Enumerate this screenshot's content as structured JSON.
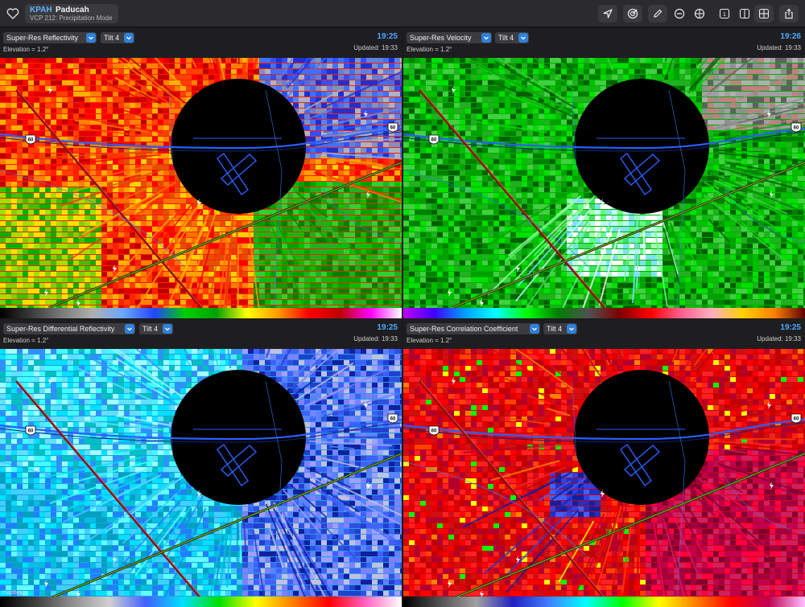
{
  "station": {
    "code": "KPAH",
    "name": "Paducah",
    "vcp": "VCP 212: Precipitation Mode"
  },
  "toolbar": {
    "icons": [
      "location-arrow-icon",
      "radar-sweep-icon",
      "pencil-icon",
      "minus-circle-icon",
      "crosshair-icon",
      "single-layout-icon",
      "dual-layout-icon",
      "quad-layout-icon",
      "share-icon"
    ],
    "single_layout_label": "1"
  },
  "panels": [
    {
      "product": "Super-Res Reflectivity",
      "tilt": "Tilt 4",
      "time": "19:25",
      "elevation": "Elevation = 1.2°",
      "updated": "Updated: 19:33",
      "palette": "reflectivity",
      "colorbar": [
        "#000000",
        "#3a3a3a",
        "#7a7a7a",
        "#b0b0b0",
        "#6aa6ff",
        "#2244ff",
        "#00d000",
        "#00a000",
        "#ffff00",
        "#ff9a00",
        "#ff0000",
        "#c00000",
        "#ff00ff",
        "#ffffff"
      ]
    },
    {
      "product": "Super-Res Velocity",
      "tilt": "Tilt 4",
      "time": "19:26",
      "elevation": "Elevation = 1.2°",
      "updated": "Updated: 19:33",
      "palette": "velocity",
      "colorbar": [
        "#c000ff",
        "#4000ff",
        "#00a0ff",
        "#00ffff",
        "#00ff00",
        "#008000",
        "#505050",
        "#800000",
        "#ff0000",
        "#ff6090",
        "#ffb0c0",
        "#ffd000",
        "#ff8000",
        "#600000"
      ]
    },
    {
      "product": "Super-Res Differential Reflectivity",
      "tilt": "Tilt 4",
      "time": "19:25",
      "elevation": "Elevation = 1.2°",
      "updated": "Updated: 19:33",
      "palette": "zdr",
      "colorbar": [
        "#000000",
        "#404040",
        "#909090",
        "#d0d0d0",
        "#4060ff",
        "#00e0ff",
        "#00e000",
        "#ffff00",
        "#ff8000",
        "#ff0000",
        "#ff60c0",
        "#ffffff"
      ]
    },
    {
      "product": "Super-Res Correlation Coefficient",
      "tilt": "Tilt 4",
      "time": "19:25",
      "elevation": "Elevation = 1.2°",
      "updated": "Updated: 19:33",
      "palette": "cc",
      "colorbar": [
        "#000000",
        "#505050",
        "#a0a0a0",
        "#2020c0",
        "#4080ff",
        "#00ffff",
        "#00ff00",
        "#ffff00",
        "#ff8000",
        "#ff0000",
        "#c00050",
        "#ffc0ff"
      ]
    }
  ],
  "map": {
    "route_shields": [
      "60",
      "60"
    ],
    "attribution": "mapbox"
  }
}
